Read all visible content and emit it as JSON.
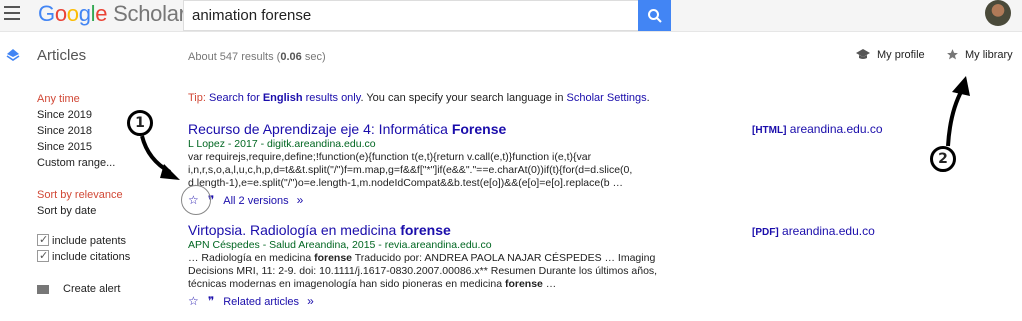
{
  "header": {
    "logo": {
      "google": [
        "G",
        "o",
        "o",
        "g",
        "l",
        "e"
      ],
      "scholar": "Scholar"
    },
    "search_value": "animation forense",
    "avatar_label": "user-avatar"
  },
  "subheader": {
    "articles_label": "Articles",
    "result_count_prefix": "About 547 results (",
    "result_count_time": "0.06",
    "result_count_suffix": " sec)",
    "my_profile": "My profile",
    "my_library": "My library"
  },
  "sidebar": {
    "time_filters": [
      "Any time",
      "Since 2019",
      "Since 2018",
      "Since 2015",
      "Custom range..."
    ],
    "sort_filters": [
      "Sort by relevance",
      "Sort by date"
    ],
    "checkboxes": [
      "include patents",
      "include citations"
    ],
    "create_alert": "Create alert"
  },
  "tip": {
    "label": "Tip:",
    "link1": "Search for",
    "link1_bold": "English",
    "link1_after": "results only",
    "text_mid": ". You can specify your search language in ",
    "link2": "Scholar Settings",
    "text_end": "."
  },
  "results": [
    {
      "title_plain": "Recurso de Aprendizaje eje 4: Informática ",
      "title_bold": "Forense",
      "meta": "L Lopez - 2017 - digitk.areandina.edu.co",
      "snippet": "var requirejs,require,define;!function(e){function t(e,t){return v.call(e,t)}function i(e,t){var i,n,r,s,o,a,l,u,c,h,p,d=t&&t.split(\"/\")f=m.map,g=f&&f[\"*\"]if(e&&\".\"==e.charAt(0))if(t){for(d=d.slice(0, d.length-1),e=e.split(\"/\")o=e.length-1,m.nodeIdCompat&&b.test(e[o])&&(e[o]=e[o].replace(b …",
      "versions": "All 2 versions",
      "related": "",
      "side_type": "[HTML]",
      "side_host": "areandina.edu.co"
    },
    {
      "title_plain": "Virtopsia. Radiología en medicina ",
      "title_bold": "forense",
      "meta": "APN Céspedes - Salud Areandina, 2015 - revia.areandina.edu.co",
      "snippet_parts": [
        "… Radiología en medicina ",
        "forense",
        " Traducido por: ANDREA PAOLA NAJAR CÉSPEDES … Imaging Decisions MRI, 11: 2-9. doi: 10.1111/j.1617-0830.2007.00086.x** Resumen Durante los últimos años, técnicas modernas en imagenología han sido pioneras en medicina ",
        "forense",
        " …"
      ],
      "versions": "",
      "related": "Related articles",
      "side_type": "[PDF]",
      "side_host": "areandina.edu.co"
    }
  ],
  "annotations": {
    "marker1": "1",
    "marker2": "2"
  },
  "colors": {
    "link": "#1a0dab",
    "meta": "#006621",
    "active": "#d14836",
    "search_button": "#4285f4"
  }
}
